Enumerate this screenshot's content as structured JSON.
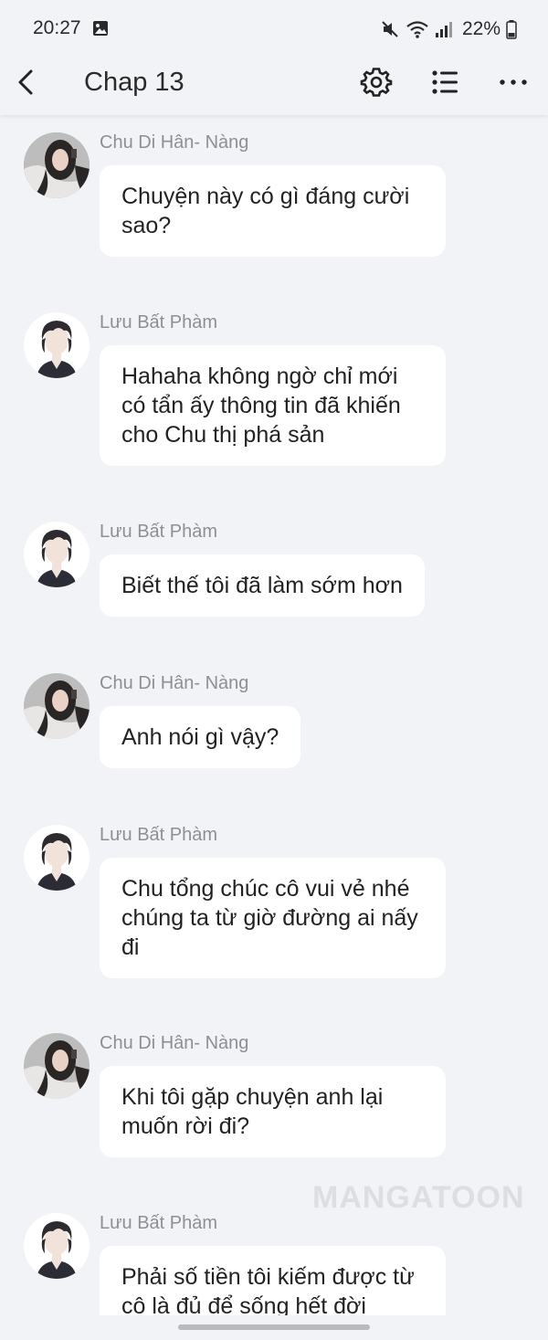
{
  "status_bar": {
    "time": "20:27",
    "battery": "22%",
    "icons": [
      "photo-icon",
      "mute-icon",
      "wifi-icon",
      "signal-icon",
      "battery-icon"
    ]
  },
  "header": {
    "title": "Chap 13",
    "icons": [
      "back-icon",
      "settings-icon",
      "list-icon",
      "more-icon"
    ]
  },
  "messages": [
    {
      "sender": "Chu Di Hân- Nàng",
      "text": "Chuyện này có gì đáng cười sao?",
      "avatar": "female-avatar"
    },
    {
      "sender": "Lưu Bất Phàm",
      "text": "Hahaha không ngờ chỉ mới có tẩn ấy thông tin đã khiến cho Chu thị phá sản",
      "avatar": "male-avatar"
    },
    {
      "sender": "Lưu Bất Phàm",
      "text": "Biết thế tôi đã làm sớm hơn",
      "avatar": "male-avatar"
    },
    {
      "sender": "Chu Di Hân- Nàng",
      "text": "Anh nói gì vậy?",
      "avatar": "female-avatar"
    },
    {
      "sender": "Lưu Bất Phàm",
      "text": "Chu tổng chúc cô vui vẻ nhé chúng ta từ giờ đường ai nấy đi",
      "avatar": "male-avatar"
    },
    {
      "sender": "Chu Di Hân- Nàng",
      "text": "Khi tôi gặp chuyện anh lại muốn rời đi?",
      "avatar": "female-avatar"
    },
    {
      "sender": "Lưu Bất Phàm",
      "text": "Phải số tiền tôi kiếm được từ cô là đủ để sống hết đời",
      "avatar": "male-avatar"
    }
  ],
  "watermark": "MANGATOON",
  "colors": {
    "background": "#f2f3f6",
    "bubble": "#ffffff",
    "sender": "#8d8f96"
  }
}
